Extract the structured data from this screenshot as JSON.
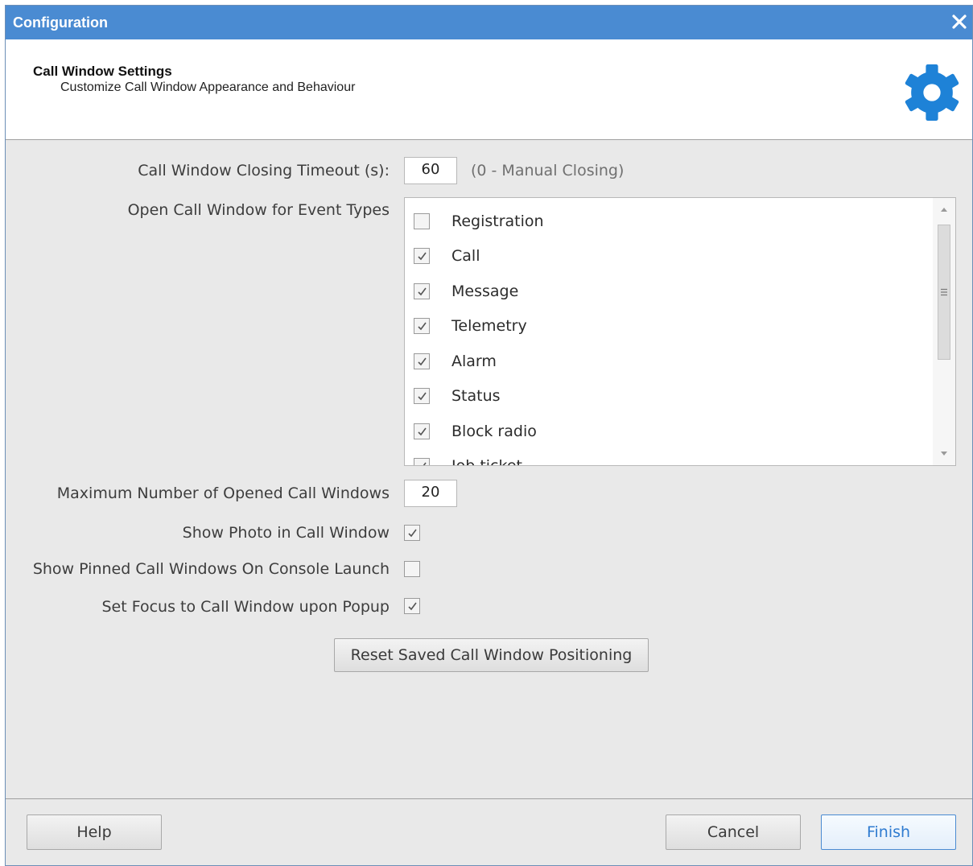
{
  "window": {
    "title": "Configuration",
    "close_icon": "close-icon"
  },
  "header": {
    "title": "Call Window Settings",
    "subtitle": "Customize Call Window Appearance and Behaviour",
    "icon": "gear-icon"
  },
  "form": {
    "timeout": {
      "label": "Call Window Closing Timeout (s):",
      "value": "60",
      "hint": "(0 - Manual Closing)"
    },
    "event_types": {
      "label": "Open Call Window for Event Types",
      "items": [
        {
          "label": "Registration",
          "checked": false
        },
        {
          "label": "Call",
          "checked": true
        },
        {
          "label": "Message",
          "checked": true
        },
        {
          "label": "Telemetry",
          "checked": true
        },
        {
          "label": "Alarm",
          "checked": true
        },
        {
          "label": "Status",
          "checked": true
        },
        {
          "label": "Block radio",
          "checked": true
        },
        {
          "label": "Job ticket",
          "checked": true
        }
      ]
    },
    "max_windows": {
      "label": "Maximum Number of Opened Call Windows",
      "value": "20"
    },
    "show_photo": {
      "label": "Show Photo in Call Window",
      "checked": true
    },
    "show_pinned": {
      "label": "Show Pinned Call Windows On Console Launch",
      "checked": false
    },
    "set_focus": {
      "label": "Set Focus to Call Window upon Popup",
      "checked": true
    },
    "reset_button": "Reset Saved Call Window Positioning"
  },
  "footer": {
    "help": "Help",
    "cancel": "Cancel",
    "finish": "Finish"
  },
  "colors": {
    "titlebar": "#4a8bd2",
    "accent": "#2f7bd0",
    "gear": "#1e82d7",
    "dialog_bg": "#e9e9e9"
  }
}
